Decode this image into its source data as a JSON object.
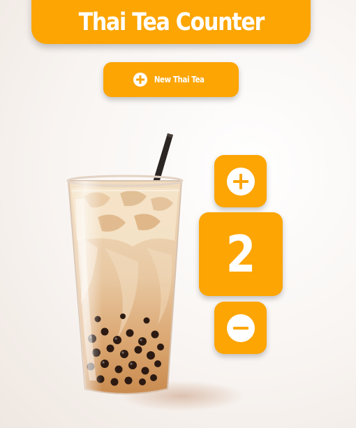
{
  "header": {
    "title": "Thai Tea Counter"
  },
  "actions": {
    "new_button_label": "New Thai Tea",
    "new_button_icon": "plus-circle-icon",
    "increment_icon": "plus-circle-icon",
    "decrement_icon": "minus-circle-icon"
  },
  "counter": {
    "value": "2"
  },
  "illustration": {
    "subject": "thai-tea-cup-icon"
  },
  "colors": {
    "accent": "#fca503",
    "text_on_accent": "#ffffff"
  }
}
